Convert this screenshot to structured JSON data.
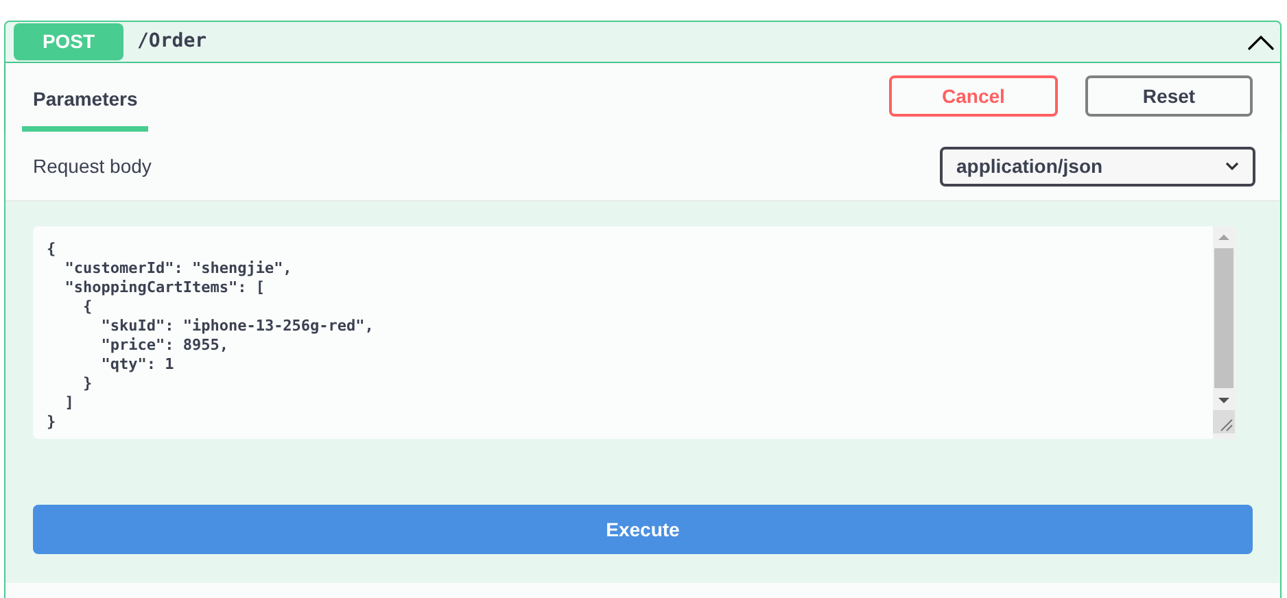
{
  "operation": {
    "method": "POST",
    "path": "/Order",
    "expanded": true
  },
  "tabs": [
    {
      "label": "Parameters",
      "selected": true
    }
  ],
  "buttons": {
    "cancel": "Cancel",
    "reset": "Reset",
    "execute": "Execute"
  },
  "request_body": {
    "label": "Request body",
    "content_type": "application/json"
  },
  "code_lines": [
    "{",
    "  \"customerId\": \"shengjie\",",
    "  \"shoppingCartItems\": [",
    "    {",
    "      \"skuId\": \"iphone-13-256g-red\",",
    "      \"price\": 8955,",
    "      \"qty\": 1",
    "    }",
    "  ]",
    "}"
  ]
}
